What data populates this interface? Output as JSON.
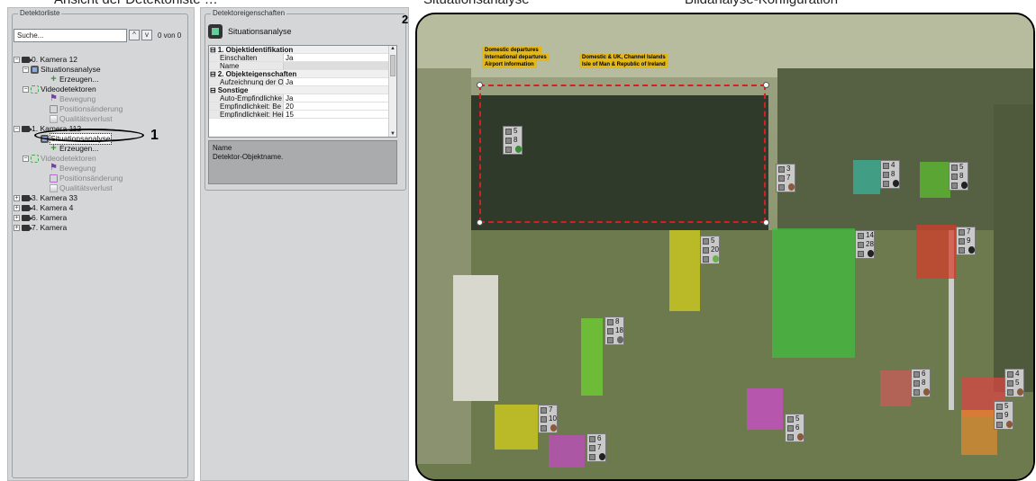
{
  "header_fragment": {
    "left": "Ansicht der Detektorliste …",
    "mid": "Situationsanalyse",
    "right": "Bildanalyse-Konfiguration"
  },
  "left_panel": {
    "title": "Detektorliste",
    "search_placeholder": "Suche...",
    "search_up": "^",
    "search_down": "v",
    "search_count": "0 von 0",
    "tree": {
      "cam0": "0. Kamera 12",
      "cam0_sit": "Situationsanalyse",
      "cam0_create": "Erzeugen...",
      "cam0_vd": "Videodetektoren",
      "cam0_move": "Bewegung",
      "cam0_pos": "Positionsänderung",
      "cam0_qual": "Qualitätsverlust",
      "cam1": "1. Kamera 112",
      "cam1_sit": "Situationsanalyse",
      "cam1_create": "Erzeugen...",
      "cam1_vd": "Videodetektoren",
      "cam1_move": "Bewegung",
      "cam1_pos": "Positionsänderung",
      "cam1_qual": "Qualitätsverlust",
      "cam3": "3. Kamera 33",
      "cam4": "4. Kamera 4",
      "cam6": "6. Kamera",
      "cam7": "7. Kamera"
    }
  },
  "markers": {
    "one": "1",
    "two": "2"
  },
  "mid_panel": {
    "title": "Detektoreigenschaften",
    "detector_name": "Situationsanalyse",
    "cat1": "1. Objektidentifikation",
    "p_einschalten": "Einschalten",
    "v_einschalten": "Ja",
    "p_name": "Name",
    "v_name": "",
    "cat2": "2. Objekteigenschaften",
    "p_aufz": "Aufzeichnung der O",
    "v_aufz": "Ja",
    "cat3": "Sonstige",
    "p_auto": "Auto-Empfindlichke",
    "v_auto": "Ja",
    "p_emp1": "Empfindlichkeit: Be",
    "v_emp1": "20",
    "p_emp2": "Empfindlichkeit: Hei",
    "v_emp2": "15",
    "desc_title": "Name",
    "desc_text": "Detektor-Objektname."
  },
  "video": {
    "signs": {
      "s1": "Domestic departures",
      "s2": "International departures",
      "s3": "Airport information",
      "s4": "Domestic & UK, Channel Islands",
      "s5": "Isle of Man & Republic of Ireland"
    },
    "badges": [
      {
        "a": "5",
        "b": "8",
        "dot": "#3a8a3a"
      },
      {
        "a": "3",
        "b": "7",
        "dot": "#8a5a3a"
      },
      {
        "a": "4",
        "b": "8",
        "dot": "#222"
      },
      {
        "a": "5",
        "b": "8",
        "dot": "#222"
      },
      {
        "a": "5",
        "b": "20",
        "dot": "#6ab04a"
      },
      {
        "a": "14",
        "b": "28",
        "dot": "#222"
      },
      {
        "a": "7",
        "b": "9",
        "dot": "#222"
      },
      {
        "a": "8",
        "b": "18",
        "dot": "#6a6a6a"
      },
      {
        "a": "6",
        "b": "8",
        "dot": "#8a5a3a"
      },
      {
        "a": "4",
        "b": "5",
        "dot": "#8a5a3a"
      },
      {
        "a": "5",
        "b": "6",
        "dot": "#8a5a3a"
      },
      {
        "a": "7",
        "b": "10",
        "dot": "#8a5a3a"
      },
      {
        "a": "6",
        "b": "7",
        "dot": "#222"
      },
      {
        "a": "5",
        "b": "9",
        "dot": "#8a5a3a"
      }
    ]
  }
}
